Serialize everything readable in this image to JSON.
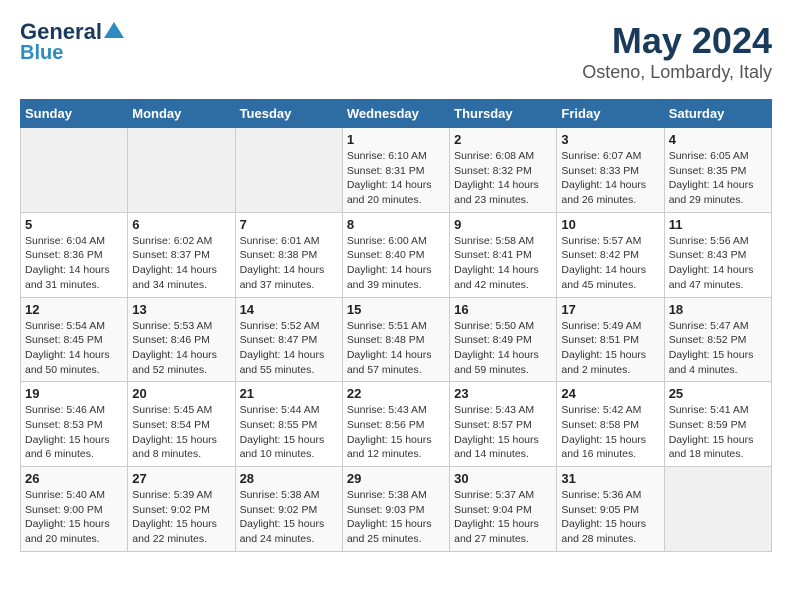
{
  "logo": {
    "line1": "General",
    "line2": "Blue"
  },
  "title": "May 2024",
  "subtitle": "Osteno, Lombardy, Italy",
  "days_of_week": [
    "Sunday",
    "Monday",
    "Tuesday",
    "Wednesday",
    "Thursday",
    "Friday",
    "Saturday"
  ],
  "weeks": [
    [
      {
        "day": "",
        "detail": ""
      },
      {
        "day": "",
        "detail": ""
      },
      {
        "day": "",
        "detail": ""
      },
      {
        "day": "1",
        "detail": "Sunrise: 6:10 AM\nSunset: 8:31 PM\nDaylight: 14 hours\nand 20 minutes."
      },
      {
        "day": "2",
        "detail": "Sunrise: 6:08 AM\nSunset: 8:32 PM\nDaylight: 14 hours\nand 23 minutes."
      },
      {
        "day": "3",
        "detail": "Sunrise: 6:07 AM\nSunset: 8:33 PM\nDaylight: 14 hours\nand 26 minutes."
      },
      {
        "day": "4",
        "detail": "Sunrise: 6:05 AM\nSunset: 8:35 PM\nDaylight: 14 hours\nand 29 minutes."
      }
    ],
    [
      {
        "day": "5",
        "detail": "Sunrise: 6:04 AM\nSunset: 8:36 PM\nDaylight: 14 hours\nand 31 minutes."
      },
      {
        "day": "6",
        "detail": "Sunrise: 6:02 AM\nSunset: 8:37 PM\nDaylight: 14 hours\nand 34 minutes."
      },
      {
        "day": "7",
        "detail": "Sunrise: 6:01 AM\nSunset: 8:38 PM\nDaylight: 14 hours\nand 37 minutes."
      },
      {
        "day": "8",
        "detail": "Sunrise: 6:00 AM\nSunset: 8:40 PM\nDaylight: 14 hours\nand 39 minutes."
      },
      {
        "day": "9",
        "detail": "Sunrise: 5:58 AM\nSunset: 8:41 PM\nDaylight: 14 hours\nand 42 minutes."
      },
      {
        "day": "10",
        "detail": "Sunrise: 5:57 AM\nSunset: 8:42 PM\nDaylight: 14 hours\nand 45 minutes."
      },
      {
        "day": "11",
        "detail": "Sunrise: 5:56 AM\nSunset: 8:43 PM\nDaylight: 14 hours\nand 47 minutes."
      }
    ],
    [
      {
        "day": "12",
        "detail": "Sunrise: 5:54 AM\nSunset: 8:45 PM\nDaylight: 14 hours\nand 50 minutes."
      },
      {
        "day": "13",
        "detail": "Sunrise: 5:53 AM\nSunset: 8:46 PM\nDaylight: 14 hours\nand 52 minutes."
      },
      {
        "day": "14",
        "detail": "Sunrise: 5:52 AM\nSunset: 8:47 PM\nDaylight: 14 hours\nand 55 minutes."
      },
      {
        "day": "15",
        "detail": "Sunrise: 5:51 AM\nSunset: 8:48 PM\nDaylight: 14 hours\nand 57 minutes."
      },
      {
        "day": "16",
        "detail": "Sunrise: 5:50 AM\nSunset: 8:49 PM\nDaylight: 14 hours\nand 59 minutes."
      },
      {
        "day": "17",
        "detail": "Sunrise: 5:49 AM\nSunset: 8:51 PM\nDaylight: 15 hours\nand 2 minutes."
      },
      {
        "day": "18",
        "detail": "Sunrise: 5:47 AM\nSunset: 8:52 PM\nDaylight: 15 hours\nand 4 minutes."
      }
    ],
    [
      {
        "day": "19",
        "detail": "Sunrise: 5:46 AM\nSunset: 8:53 PM\nDaylight: 15 hours\nand 6 minutes."
      },
      {
        "day": "20",
        "detail": "Sunrise: 5:45 AM\nSunset: 8:54 PM\nDaylight: 15 hours\nand 8 minutes."
      },
      {
        "day": "21",
        "detail": "Sunrise: 5:44 AM\nSunset: 8:55 PM\nDaylight: 15 hours\nand 10 minutes."
      },
      {
        "day": "22",
        "detail": "Sunrise: 5:43 AM\nSunset: 8:56 PM\nDaylight: 15 hours\nand 12 minutes."
      },
      {
        "day": "23",
        "detail": "Sunrise: 5:43 AM\nSunset: 8:57 PM\nDaylight: 15 hours\nand 14 minutes."
      },
      {
        "day": "24",
        "detail": "Sunrise: 5:42 AM\nSunset: 8:58 PM\nDaylight: 15 hours\nand 16 minutes."
      },
      {
        "day": "25",
        "detail": "Sunrise: 5:41 AM\nSunset: 8:59 PM\nDaylight: 15 hours\nand 18 minutes."
      }
    ],
    [
      {
        "day": "26",
        "detail": "Sunrise: 5:40 AM\nSunset: 9:00 PM\nDaylight: 15 hours\nand 20 minutes."
      },
      {
        "day": "27",
        "detail": "Sunrise: 5:39 AM\nSunset: 9:02 PM\nDaylight: 15 hours\nand 22 minutes."
      },
      {
        "day": "28",
        "detail": "Sunrise: 5:38 AM\nSunset: 9:02 PM\nDaylight: 15 hours\nand 24 minutes."
      },
      {
        "day": "29",
        "detail": "Sunrise: 5:38 AM\nSunset: 9:03 PM\nDaylight: 15 hours\nand 25 minutes."
      },
      {
        "day": "30",
        "detail": "Sunrise: 5:37 AM\nSunset: 9:04 PM\nDaylight: 15 hours\nand 27 minutes."
      },
      {
        "day": "31",
        "detail": "Sunrise: 5:36 AM\nSunset: 9:05 PM\nDaylight: 15 hours\nand 28 minutes."
      },
      {
        "day": "",
        "detail": ""
      }
    ]
  ]
}
